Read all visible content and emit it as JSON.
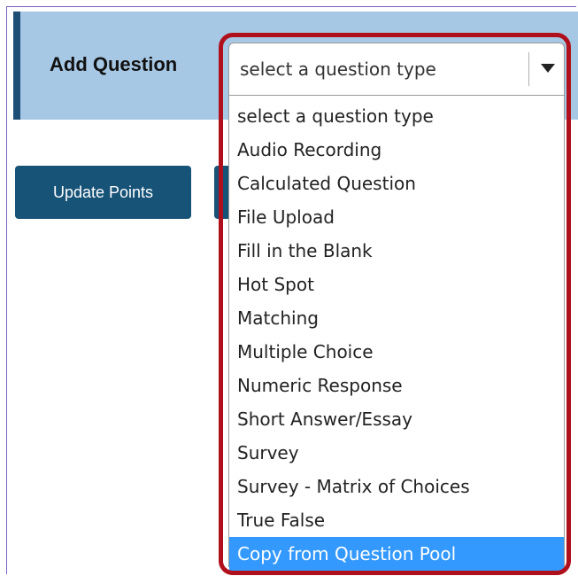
{
  "header": {
    "title": "Add Question"
  },
  "question_type_select": {
    "value": "select a question type",
    "options": [
      "select a question type",
      "Audio Recording",
      "Calculated Question",
      "File Upload",
      "Fill in the Blank",
      "Hot Spot",
      "Matching",
      "Multiple Choice",
      "Numeric Response",
      "Short Answer/Essay",
      "Survey",
      "Survey - Matrix of Choices",
      "True False",
      "Copy from Question Pool"
    ],
    "highlighted_option": "Copy from Question Pool"
  },
  "toolbar": {
    "update_points_label": "Update Points"
  },
  "colors": {
    "header_bg": "#a7c8e4",
    "header_accent": "#1d4f76",
    "button_bg": "#175277",
    "highlight_border": "#b0101c",
    "option_highlight": "#3399ff"
  },
  "icons": {
    "dropdown": "chevron-down-icon"
  }
}
